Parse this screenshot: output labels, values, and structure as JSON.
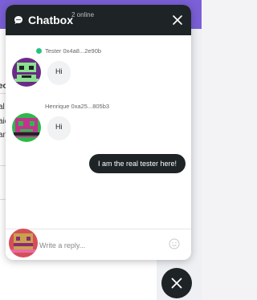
{
  "background": {
    "fragments": [
      "ec",
      "al",
      "aic",
      "an"
    ]
  },
  "chat": {
    "title": "Chatbox",
    "online": "2 online",
    "icons": {
      "header": "chat-bubble-icon",
      "close": "close-icon",
      "emoji": "smiley-icon",
      "fab": "close-icon"
    },
    "messages": [
      {
        "sender": "Tester 0x4a8...2e90b",
        "text": "Hi",
        "online": true
      },
      {
        "sender": "Henrique 0xa25...805b3",
        "text": "Hi",
        "online": false
      },
      {
        "text": "I am the real tester here!",
        "own": true
      }
    ],
    "composer": {
      "placeholder": "Write a reply..."
    }
  },
  "colors": {
    "header": "#1e2426",
    "accent": "#7a5fd6",
    "online": "#26c281"
  }
}
